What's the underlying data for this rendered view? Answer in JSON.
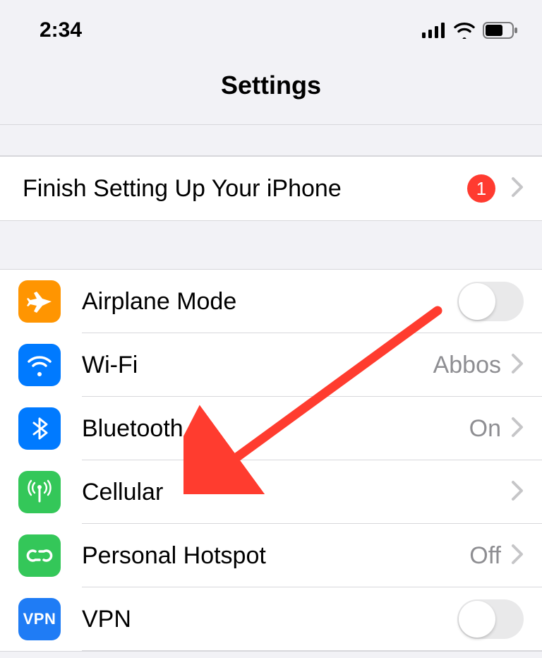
{
  "status": {
    "time": "2:34"
  },
  "nav": {
    "title": "Settings"
  },
  "setup": {
    "label": "Finish Setting Up Your iPhone",
    "badge": "1"
  },
  "rows": {
    "airplane": {
      "label": "Airplane Mode"
    },
    "wifi": {
      "label": "Wi-Fi",
      "value": "Abbos"
    },
    "bluetooth": {
      "label": "Bluetooth",
      "value": "On"
    },
    "cellular": {
      "label": "Cellular"
    },
    "hotspot": {
      "label": "Personal Hotspot",
      "value": "Off"
    },
    "vpn": {
      "label": "VPN",
      "icon_text": "VPN"
    }
  }
}
